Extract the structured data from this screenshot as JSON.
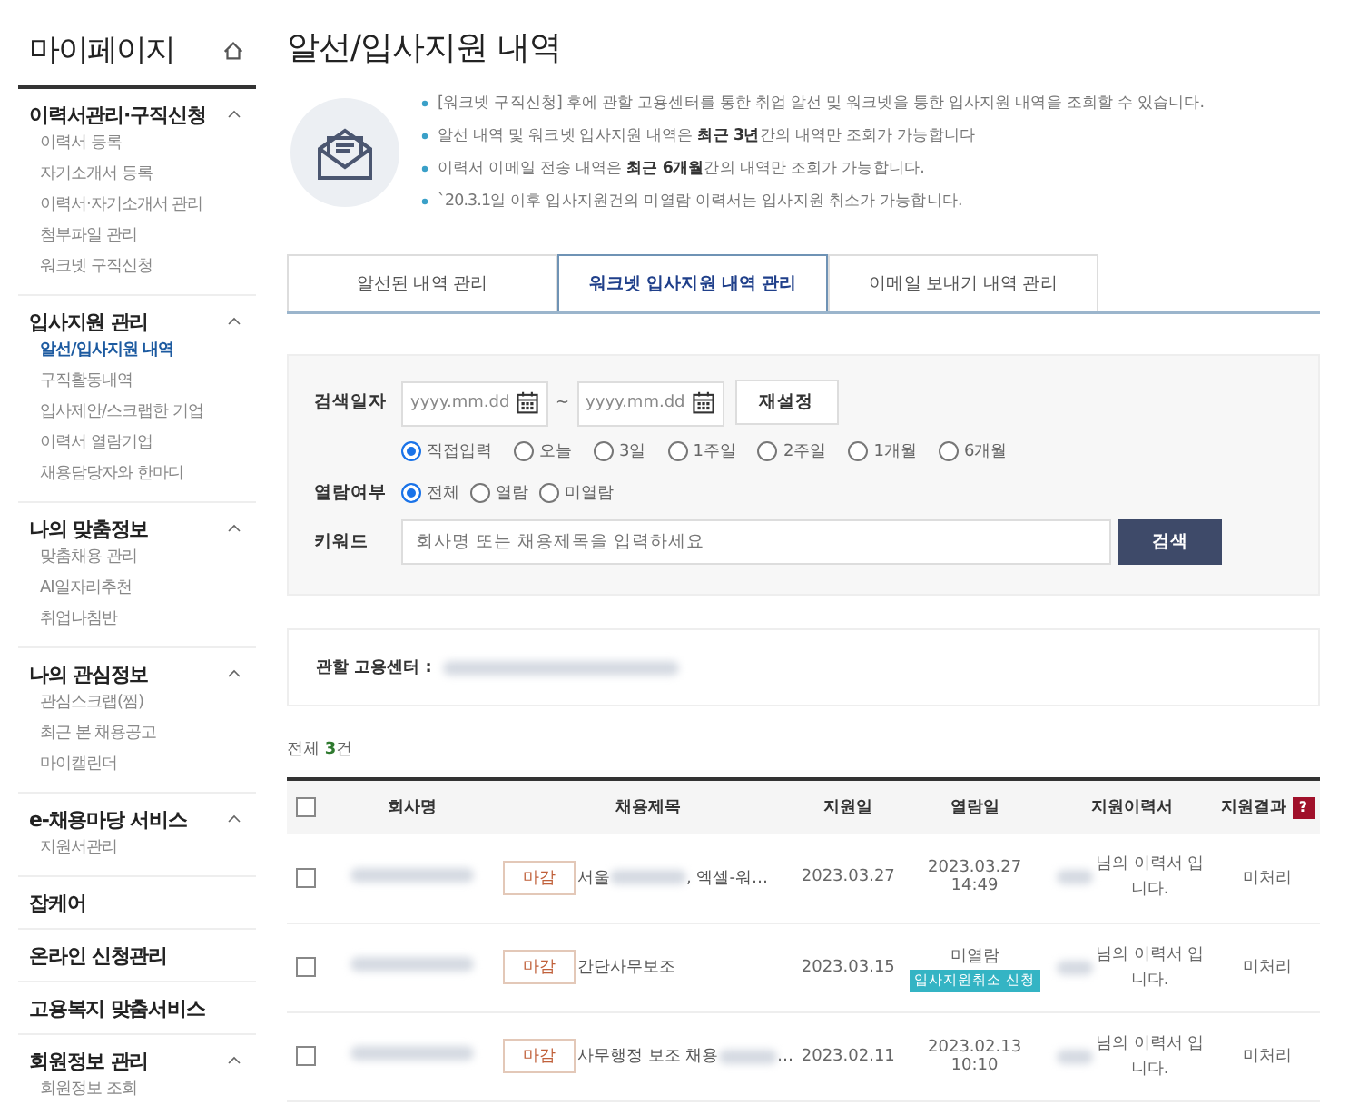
{
  "sidebar": {
    "title": "마이페이지",
    "groups": [
      {
        "label": "이력서관리·구직신청",
        "expanded": true,
        "items": [
          {
            "label": "이력서 등록",
            "selected": false
          },
          {
            "label": "자기소개서 등록",
            "selected": false
          },
          {
            "label": "이력서·자기소개서 관리",
            "selected": false
          },
          {
            "label": "첨부파일 관리",
            "selected": false
          },
          {
            "label": "워크넷 구직신청",
            "selected": false
          }
        ]
      },
      {
        "label": "입사지원 관리",
        "expanded": true,
        "items": [
          {
            "label": "알선/입사지원 내역",
            "selected": true
          },
          {
            "label": "구직활동내역",
            "selected": false
          },
          {
            "label": "입사제안/스크랩한 기업",
            "selected": false
          },
          {
            "label": "이력서 열람기업",
            "selected": false
          },
          {
            "label": "채용담당자와 한마디",
            "selected": false
          }
        ]
      },
      {
        "label": "나의 맞춤정보",
        "expanded": true,
        "items": [
          {
            "label": "맞춤채용 관리",
            "selected": false
          },
          {
            "label": "AI일자리추천",
            "selected": false
          },
          {
            "label": "취업나침반",
            "selected": false
          }
        ]
      },
      {
        "label": "나의 관심정보",
        "expanded": true,
        "items": [
          {
            "label": "관심스크랩(찜)",
            "selected": false
          },
          {
            "label": "최근 본 채용공고",
            "selected": false
          },
          {
            "label": "마이캘린더",
            "selected": false
          }
        ]
      },
      {
        "label": "e-채용마당 서비스",
        "expanded": true,
        "items": [
          {
            "label": "지원서관리",
            "selected": false
          }
        ]
      },
      {
        "label": "잡케어",
        "expanded": false
      },
      {
        "label": "온라인 신청관리",
        "expanded": false
      },
      {
        "label": "고용복지 맞춤서비스",
        "expanded": false
      },
      {
        "label": "회원정보 관리",
        "expanded": true,
        "items": [
          {
            "label": "회원정보 조회",
            "selected": false
          }
        ]
      }
    ]
  },
  "page_title": "알선/입사지원 내역",
  "notices": [
    "[워크넷 구직신청] 후에 관할 고용센터를 통한 취업 알선 및 워크넷을 통한 입사지원 내역을 조회할 수 있습니다.",
    "알선 내역 및 워크넷 입사지원 내역은 **최근 3년**간의 내역만 조회가 가능합니다",
    "이력서 이메일 전송 내역은 **최근 6개월**간의 내역만 조회가 가능합니다.",
    "`20.3.1일 이후 입사지원건의 미열람 이력서는 입사지원 취소가 가능합니다."
  ],
  "tabs": [
    {
      "label": "알선된 내역 관리",
      "selected": false
    },
    {
      "label": "워크넷 입사지원 내역 관리",
      "selected": true
    },
    {
      "label": "이메일 보내기 내역 관리",
      "selected": false
    }
  ],
  "search": {
    "date_label": "검색일자",
    "date_from": {
      "placeholder": "yyyy.mm.dd"
    },
    "separator": "~",
    "date_to": {
      "placeholder": "yyyy.mm.dd"
    },
    "reset": "재설정",
    "periods": [
      {
        "label": "직접입력",
        "selected": true
      },
      {
        "label": "오늘",
        "selected": false
      },
      {
        "label": "3일",
        "selected": false
      },
      {
        "label": "1주일",
        "selected": false
      },
      {
        "label": "2주일",
        "selected": false
      },
      {
        "label": "1개월",
        "selected": false
      },
      {
        "label": "6개월",
        "selected": false
      }
    ],
    "view_label": "열람여부",
    "views": [
      {
        "label": "전체",
        "selected": true
      },
      {
        "label": "열람",
        "selected": false
      },
      {
        "label": "미열람",
        "selected": false
      }
    ],
    "keyword_label": "키워드",
    "keyword": {
      "placeholder": "회사명 또는 채용제목을 입력하세요"
    },
    "submit": "검색"
  },
  "center": {
    "label": "관할 고용센터 :"
  },
  "count": "전체 **3**건",
  "table": {
    "select_all": {
      "checked": false
    },
    "columns": [
      "회사명",
      "채용제목",
      "지원일",
      "열람일",
      "지원이력서",
      "지원결과"
    ],
    "help": "?",
    "rows": [
      {
        "checked": false,
        "tag": "마감",
        "title": "서울",
        "title_end": ", 엑셀-워…",
        "applied": "2023.03.27",
        "viewed": [
          "2023.03.27",
          "14:49"
        ],
        "resume": "님의 이력서 입니다.",
        "result": "미처리"
      },
      {
        "checked": false,
        "tag": "마감",
        "title": "간단사무보조",
        "applied": "2023.03.15",
        "viewed": [
          "미열람"
        ],
        "cancel": "입사지원취소 신청",
        "resume": "님의 이력서 입니다.",
        "result": "미처리"
      },
      {
        "checked": false,
        "tag": "마감",
        "title": "사무행정 보조 채용",
        "title_end": "…",
        "applied": "2023.02.11",
        "viewed": [
          "2023.02.13",
          "10:10"
        ],
        "resume": "님의 이력서 입니다.",
        "result": "미처리"
      }
    ]
  }
}
